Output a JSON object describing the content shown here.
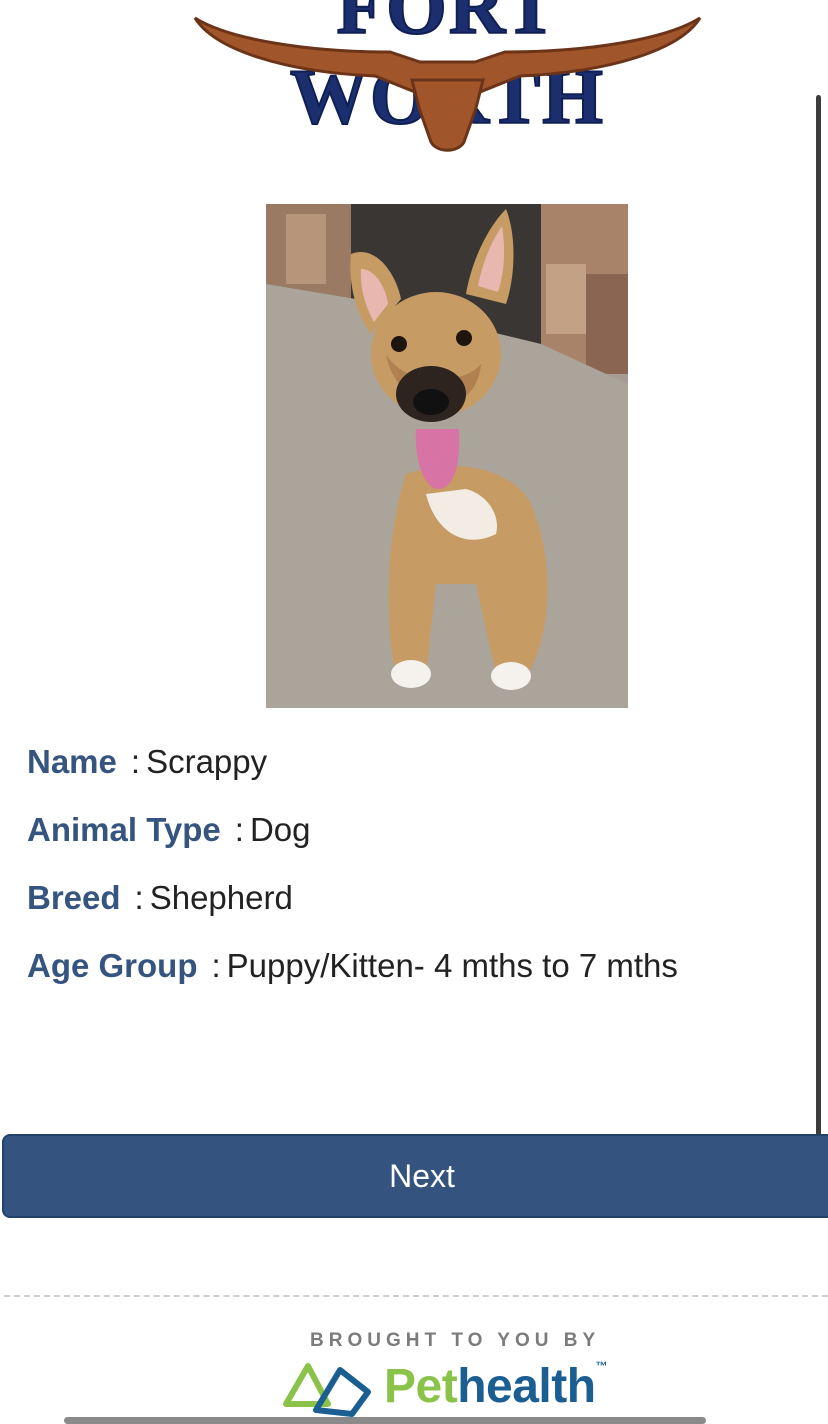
{
  "header": {
    "logo_text": "FORT WORTH"
  },
  "pet": {
    "fields": [
      {
        "label": "Name",
        "value": "Scrappy"
      },
      {
        "label": "Animal Type",
        "value": "Dog"
      },
      {
        "label": "Breed",
        "value": "Shepherd"
      },
      {
        "label": "Age Group",
        "value": "Puppy/Kitten- 4 mths to 7 mths"
      }
    ],
    "separator": ":"
  },
  "actions": {
    "next_label": "Next"
  },
  "footer": {
    "brought_by": "BROUGHT TO YOU BY",
    "brand_pet": "Pet",
    "brand_health": "health",
    "trademark": "™"
  },
  "colors": {
    "label": "#35547f",
    "button": "#34547f",
    "brand_green": "#8bc34a",
    "brand_blue": "#1b5e92",
    "longhorn": "#a0522d"
  }
}
